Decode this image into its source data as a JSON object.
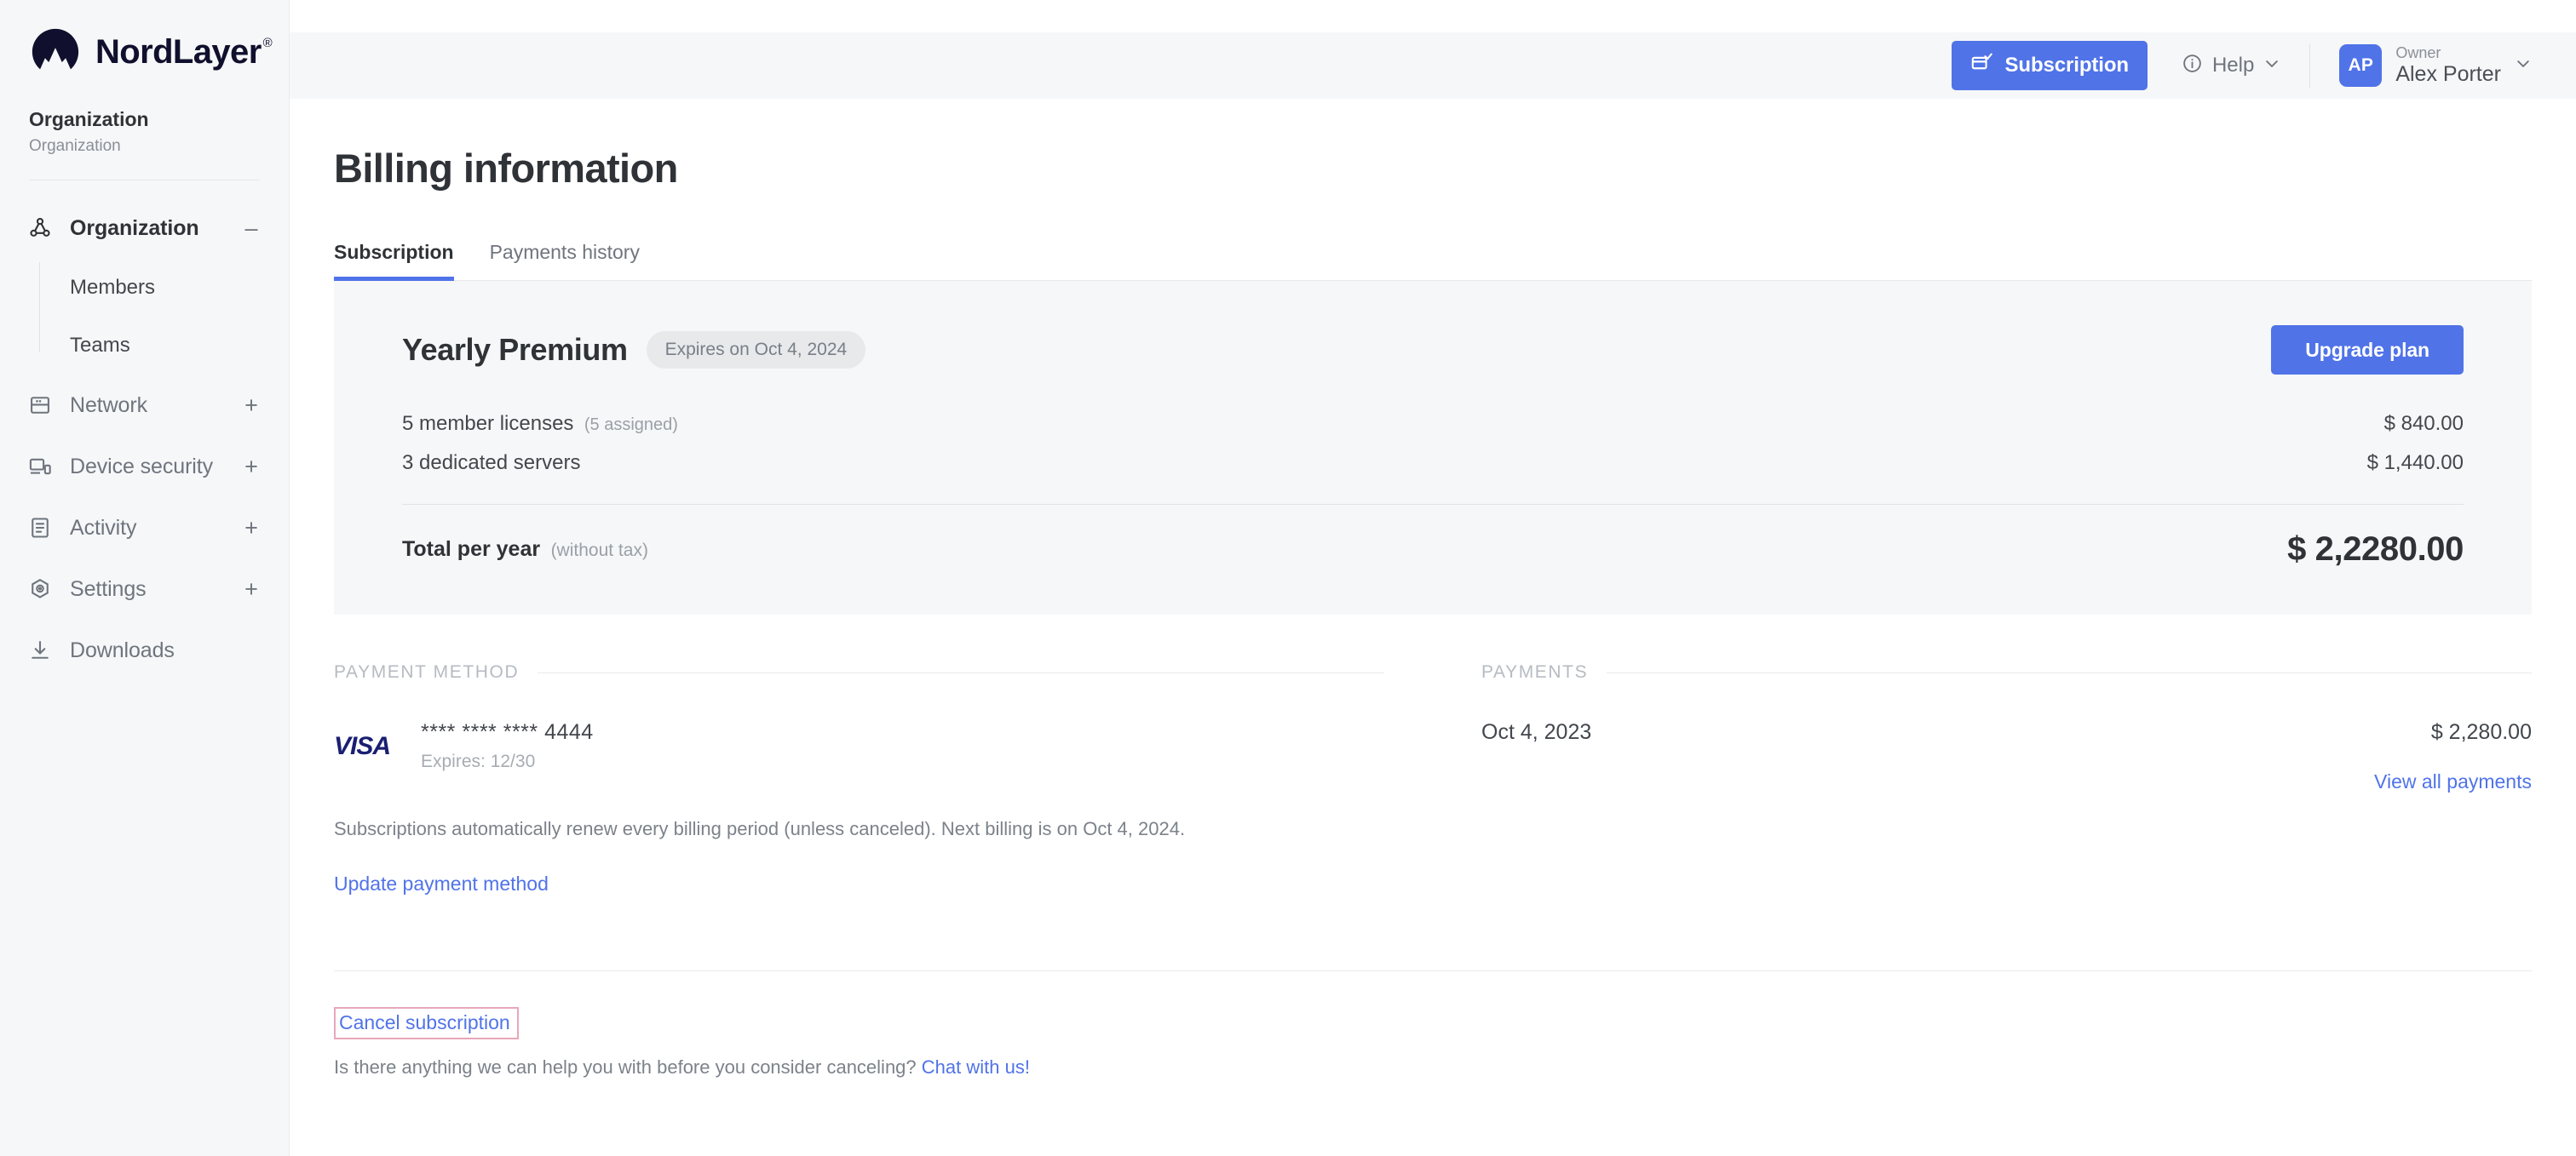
{
  "brand": {
    "name": "NordLayer",
    "tm": "®"
  },
  "sidebar": {
    "org_title": "Organization",
    "org_subtitle": "Organization",
    "nav": [
      {
        "label": "Organization",
        "icon": "organization-icon",
        "toggle": "–",
        "active": true
      },
      {
        "label": "Network",
        "icon": "network-icon",
        "toggle": "+",
        "active": false
      },
      {
        "label": "Device security",
        "icon": "device-security-icon",
        "toggle": "+",
        "active": false
      },
      {
        "label": "Activity",
        "icon": "activity-icon",
        "toggle": "+",
        "active": false
      },
      {
        "label": "Settings",
        "icon": "settings-icon",
        "toggle": "+",
        "active": false
      },
      {
        "label": "Downloads",
        "icon": "downloads-icon",
        "toggle": "",
        "active": false
      }
    ],
    "sub_items": [
      {
        "label": "Members"
      },
      {
        "label": "Teams"
      }
    ]
  },
  "topbar": {
    "subscription_label": "Subscription",
    "subscription_icon": "billing-card-check-icon",
    "help_label": "Help",
    "help_icon": "info-circle-icon",
    "chevron_icon": "chevron-down-icon",
    "avatar_initials": "AP",
    "user_role": "Owner",
    "user_name": "Alex Porter"
  },
  "page": {
    "title": "Billing information",
    "tabs": [
      {
        "label": "Subscription",
        "active": true
      },
      {
        "label": "Payments history",
        "active": false
      }
    ]
  },
  "plan": {
    "name": "Yearly Premium",
    "badge": "Expires on Oct 4, 2024",
    "upgrade_label": "Upgrade plan",
    "line_items": [
      {
        "label": "5 member licenses",
        "note": "(5 assigned)",
        "amount": "$ 840.00"
      },
      {
        "label": "3 dedicated servers",
        "note": "",
        "amount": "$ 1,440.00"
      }
    ],
    "total_label": "Total per year",
    "total_note": "(without tax)",
    "total_amount": "$ 2,2280.00"
  },
  "payment_method": {
    "section_title": "PAYMENT METHOD",
    "brand": "VISA",
    "masked_number": "**** **** **** 4444",
    "expires": "Expires: 12/30"
  },
  "payments": {
    "section_title": "PAYMENTS",
    "rows": [
      {
        "date": "Oct 4, 2023",
        "amount": "$ 2,280.00"
      }
    ],
    "view_all_label": "View all payments"
  },
  "footer": {
    "renew_note": "Subscriptions automatically renew every billing period (unless canceled). Next billing is on Oct 4, 2024.",
    "update_payment_label": "Update payment method",
    "cancel_label": "Cancel subscription",
    "help_question": "Is there anything we can help you with before you consider canceling?",
    "chat_label": "Chat with us!"
  },
  "colors": {
    "accent": "#5073E8",
    "sidebar_bg": "#F6F7F8",
    "card_bg": "#F6F7F8",
    "highlight_border": "#E9A7B9",
    "visa_blue": "#1A1F71"
  }
}
